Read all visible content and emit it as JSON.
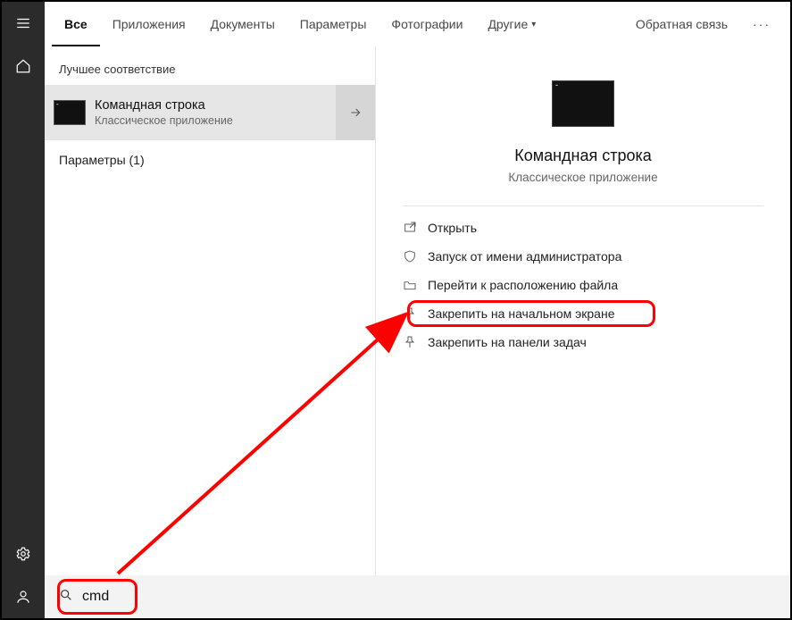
{
  "tabs": {
    "all": "Все",
    "apps": "Приложения",
    "docs": "Документы",
    "settings": "Параметры",
    "photos": "Фотографии",
    "other": "Другие",
    "feedback": "Обратная связь"
  },
  "left": {
    "best_label": "Лучшее соответствие",
    "result_title": "Командная строка",
    "result_sub": "Классическое приложение",
    "params": "Параметры (1)"
  },
  "right": {
    "title": "Командная строка",
    "sub": "Классическое приложение",
    "actions": {
      "open": "Открыть",
      "run_admin": "Запуск от имени администратора",
      "go_location": "Перейти к расположению файла",
      "pin_start": "Закрепить на начальном экране",
      "pin_taskbar": "Закрепить на панели задач"
    }
  },
  "search": {
    "value": "cmd",
    "placeholder": ""
  }
}
